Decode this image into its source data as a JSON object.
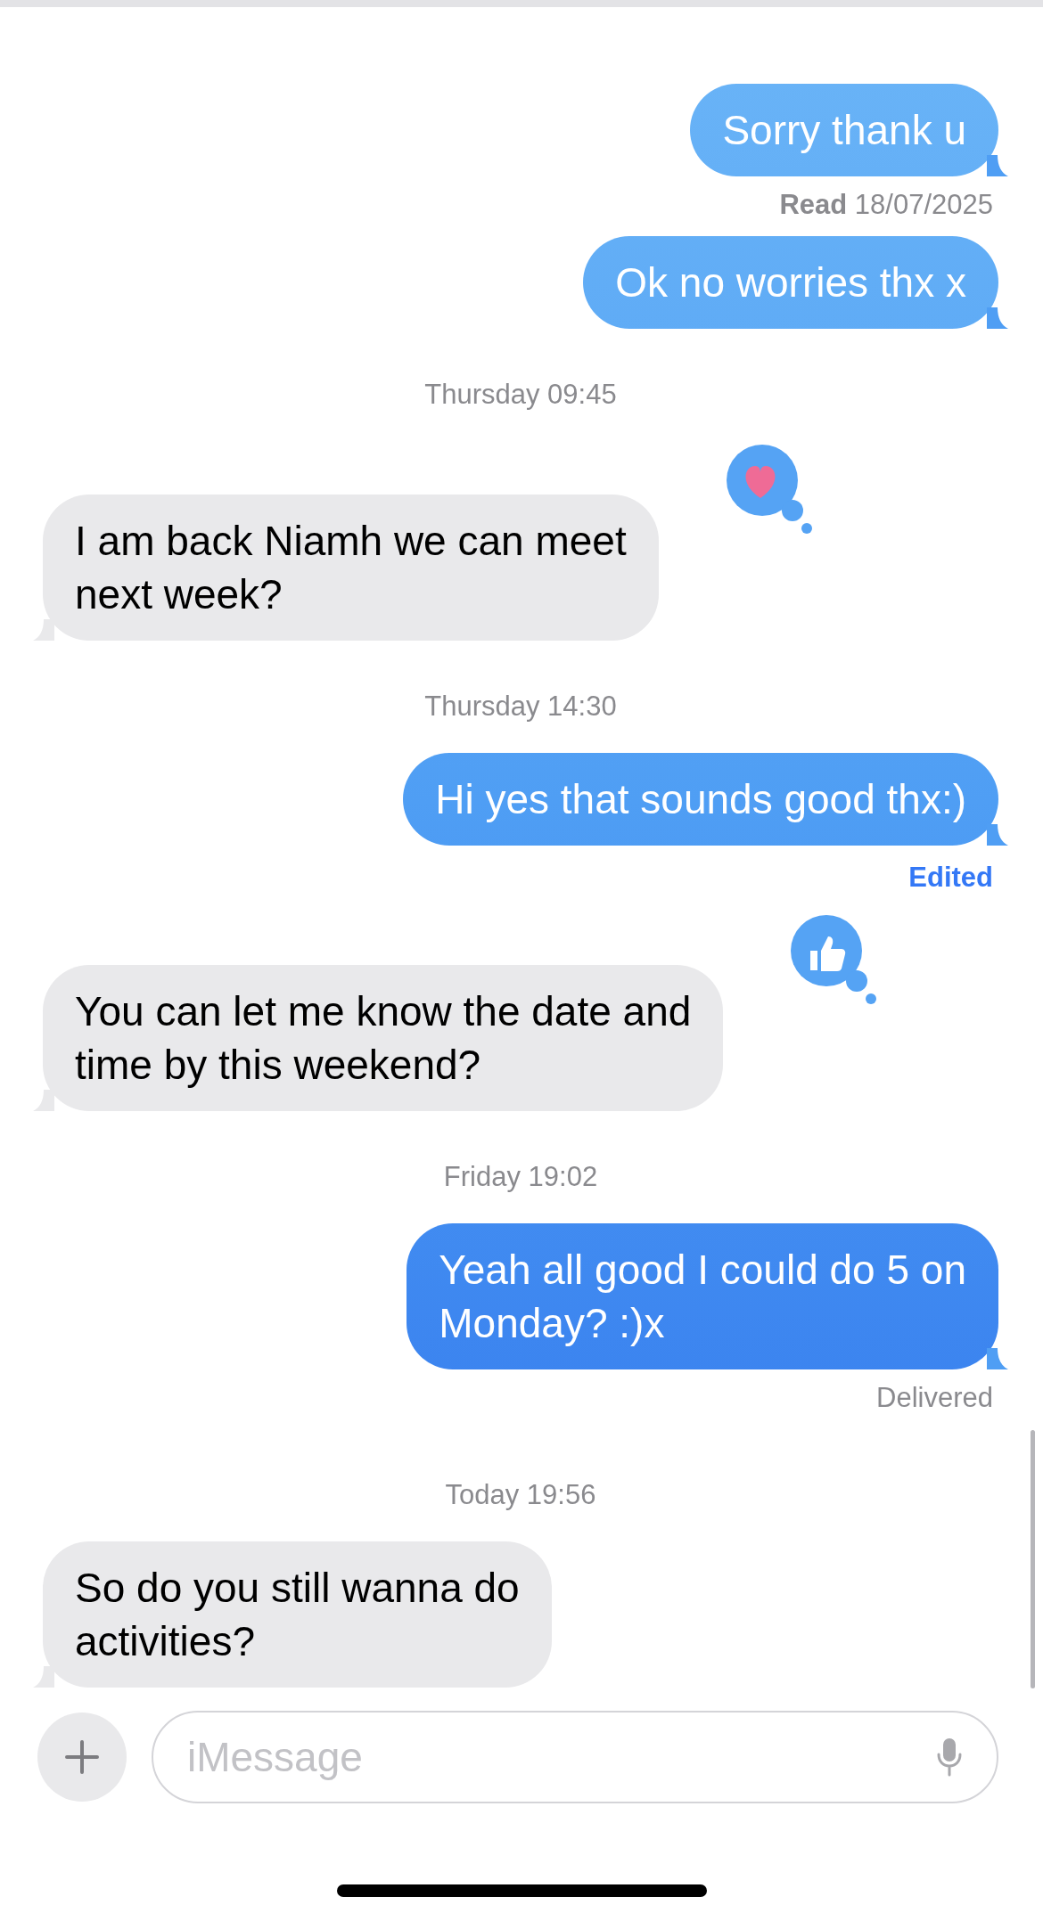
{
  "messages": [
    {
      "kind": "sent",
      "text": "Sorry thank u"
    },
    {
      "kind": "status",
      "text": "**Read** 18/07/2025"
    },
    {
      "kind": "sent",
      "text": "Ok no worries thx x"
    },
    {
      "kind": "timestamp",
      "text": "Thursday 09:45"
    },
    {
      "kind": "received",
      "text": "I am back Niamh we can meet\nnext week?",
      "reaction": {
        "kind": "heart"
      }
    },
    {
      "kind": "timestamp",
      "text": "Thursday 14:30"
    },
    {
      "kind": "sent",
      "text": "Hi yes that sounds good thx:)"
    },
    {
      "kind": "edited",
      "text": "Edited"
    },
    {
      "kind": "received",
      "text": "You can let me know the date and\ntime by this weekend?",
      "reaction": {
        "kind": "thumbs-up"
      }
    },
    {
      "kind": "timestamp",
      "text": "Friday 19:02"
    },
    {
      "kind": "sent",
      "text": "Yeah all good I could do 5 on\nMonday? :)x"
    },
    {
      "kind": "status",
      "text": "Delivered"
    },
    {
      "kind": "timestamp",
      "text": "Today 19:56"
    },
    {
      "kind": "received",
      "text": "So do you still wanna do\nactivities?"
    }
  ],
  "composer": {
    "placeholder": "iMessage"
  }
}
